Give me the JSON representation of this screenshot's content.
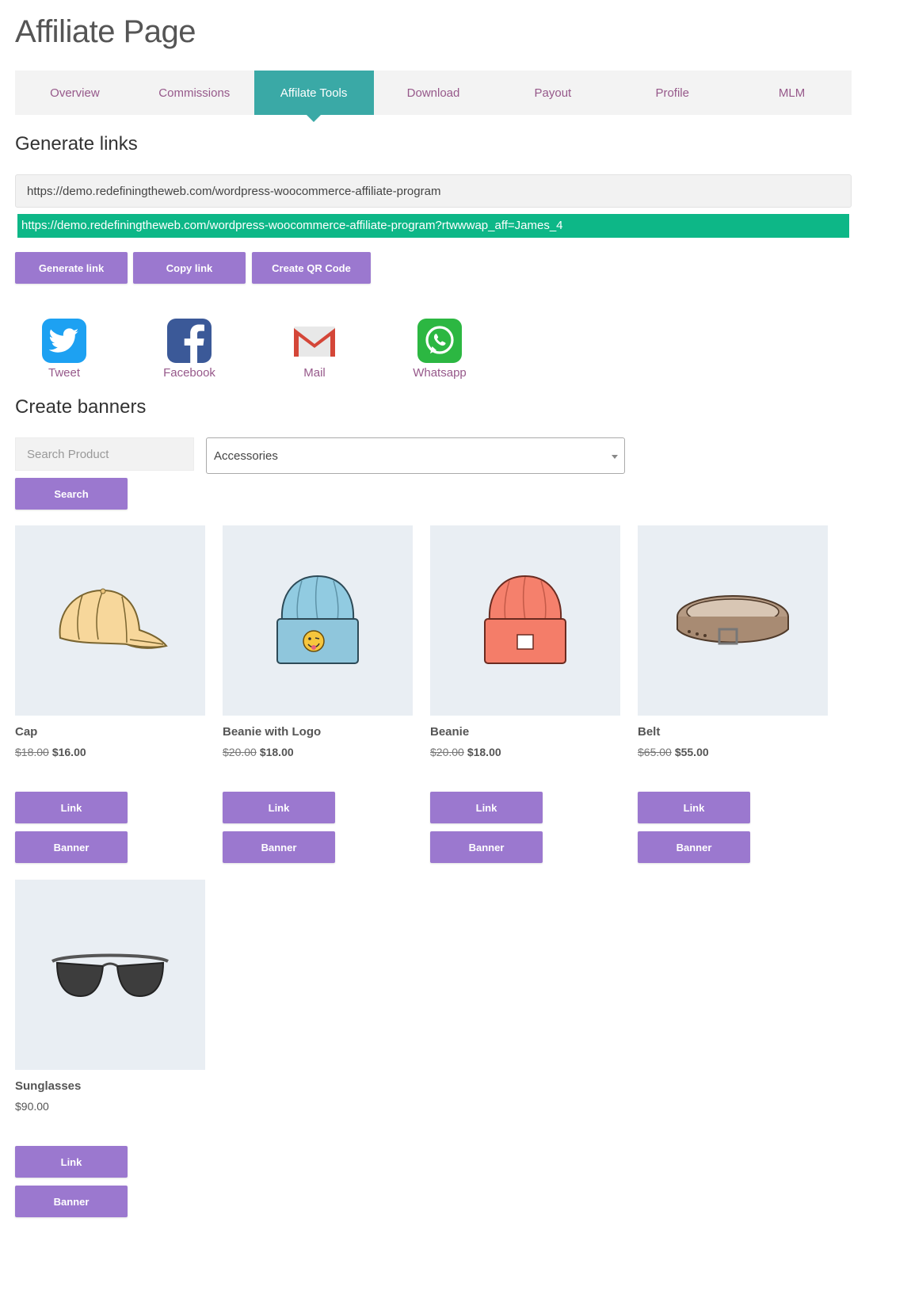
{
  "page": {
    "title": "Affiliate Page"
  },
  "tabs": [
    {
      "label": "Overview"
    },
    {
      "label": "Commissions"
    },
    {
      "label": "Affilate Tools",
      "active": true
    },
    {
      "label": "Download"
    },
    {
      "label": "Payout"
    },
    {
      "label": "Profile"
    },
    {
      "label": "MLM"
    }
  ],
  "generate_links": {
    "title": "Generate links",
    "url_value": "https://demo.redefiningtheweb.com/wordpress-woocommerce-affiliate-program",
    "generated_link": "https://demo.redefiningtheweb.com/wordpress-woocommerce-affiliate-program?rtwwwap_aff=James_4",
    "buttons": {
      "generate": "Generate link",
      "copy": "Copy link",
      "qr": "Create QR Code"
    }
  },
  "share": [
    {
      "label": "Tweet",
      "icon": "twitter-icon",
      "color": "#1da1f2"
    },
    {
      "label": "Facebook",
      "icon": "facebook-icon",
      "color": "#3b5998"
    },
    {
      "label": "Mail",
      "icon": "mail-icon",
      "color": "#d44638"
    },
    {
      "label": "Whatsapp",
      "icon": "whatsapp-icon",
      "color": "#2cb742"
    }
  ],
  "banners": {
    "title": "Create banners",
    "search_placeholder": "Search Product",
    "category_selected": "Accessories",
    "search_button": "Search"
  },
  "products": [
    {
      "name": "Cap",
      "old_price": "$18.00",
      "price": "$16.00",
      "image": "cap"
    },
    {
      "name": "Beanie with Logo",
      "old_price": "$20.00",
      "price": "$18.00",
      "image": "beanie-logo"
    },
    {
      "name": "Beanie",
      "old_price": "$20.00",
      "price": "$18.00",
      "image": "beanie"
    },
    {
      "name": "Belt",
      "old_price": "$65.00",
      "price": "$55.00",
      "image": "belt"
    },
    {
      "name": "Sunglasses",
      "old_price": "",
      "price": "$90.00",
      "image": "sunglasses"
    }
  ],
  "product_buttons": {
    "link": "Link",
    "banner": "Banner"
  },
  "colors": {
    "accent_tab": "#3aa9a6",
    "button": "#9b78cf",
    "link_text": "#96588a",
    "generated_link_bg": "#0db787"
  }
}
